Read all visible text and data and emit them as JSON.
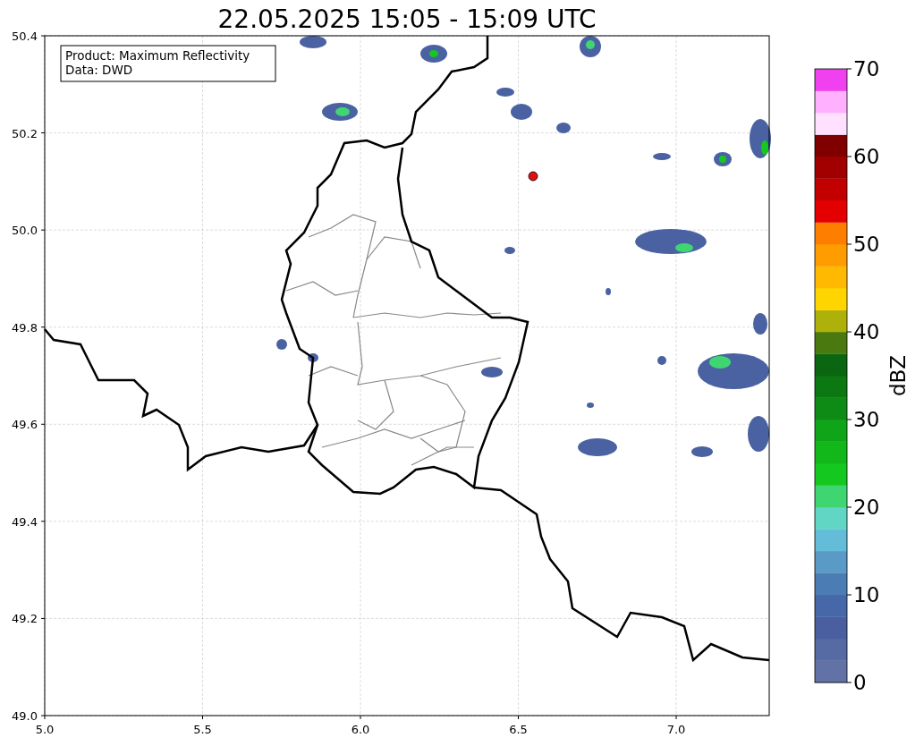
{
  "title": "22.05.2025 15:05 - 15:09 UTC",
  "legend": [
    "Product: Maximum Reflectivity",
    "Data: DWD"
  ],
  "map": {
    "xticks": [
      "5.0",
      "5.5",
      "6.0",
      "6.5",
      "7.0"
    ],
    "yticks": [
      "50.4",
      "50.2",
      "50.0",
      "49.8",
      "49.6",
      "49.4",
      "49.2",
      "49.0"
    ]
  },
  "colorbar": {
    "label": "dBZ",
    "ticks": [
      "70",
      "60",
      "50",
      "40",
      "30",
      "20",
      "10",
      "0"
    ],
    "segments": [
      {
        "color": "#6272a6"
      },
      {
        "color": "#566aa3"
      },
      {
        "color": "#4a5fa0"
      },
      {
        "color": "#4667a8"
      },
      {
        "color": "#4b7db4"
      },
      {
        "color": "#5a9ac6"
      },
      {
        "color": "#63bdd8"
      },
      {
        "color": "#61d6c4"
      },
      {
        "color": "#3fd672"
      },
      {
        "color": "#15c81f"
      },
      {
        "color": "#12b81a"
      },
      {
        "color": "#10a418"
      },
      {
        "color": "#0e8b14"
      },
      {
        "color": "#0b7812"
      },
      {
        "color": "#0a6610"
      },
      {
        "color": "#4a7a0f"
      },
      {
        "color": "#adb10a"
      },
      {
        "color": "#fed500"
      },
      {
        "color": "#feb900"
      },
      {
        "color": "#fe9c00"
      },
      {
        "color": "#fe7f00"
      },
      {
        "color": "#e40000"
      },
      {
        "color": "#c20000"
      },
      {
        "color": "#a20000"
      },
      {
        "color": "#800000"
      },
      {
        "color": "#ffe0ff"
      },
      {
        "color": "#ffb0ff"
      },
      {
        "color": "#f040f0"
      }
    ]
  }
}
